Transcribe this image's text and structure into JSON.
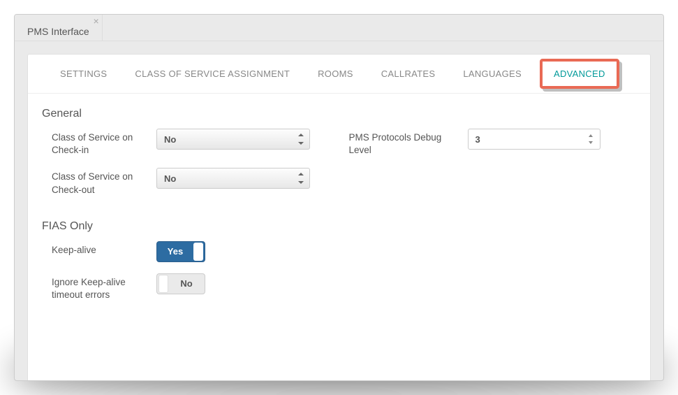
{
  "window": {
    "tab_title": "PMS Interface"
  },
  "nav": {
    "settings": "SETTINGS",
    "cos_assignment": "CLASS OF SERVICE ASSIGNMENT",
    "rooms": "ROOMS",
    "callrates": "CALLRATES",
    "languages": "LANGUAGES",
    "advanced": "ADVANCED"
  },
  "sections": {
    "general": {
      "title": "General",
      "cos_checkin_label": "Class of Service on Check-in",
      "cos_checkin_value": "No",
      "cos_checkout_label": "Class of Service on Check-out",
      "cos_checkout_value": "No",
      "debug_label": "PMS Protocols Debug Level",
      "debug_value": "3"
    },
    "fias": {
      "title": "FIAS Only",
      "keepalive_label": "Keep-alive",
      "keepalive_value": "Yes",
      "ignore_label": "Ignore Keep-alive timeout errors",
      "ignore_value": "No"
    }
  }
}
